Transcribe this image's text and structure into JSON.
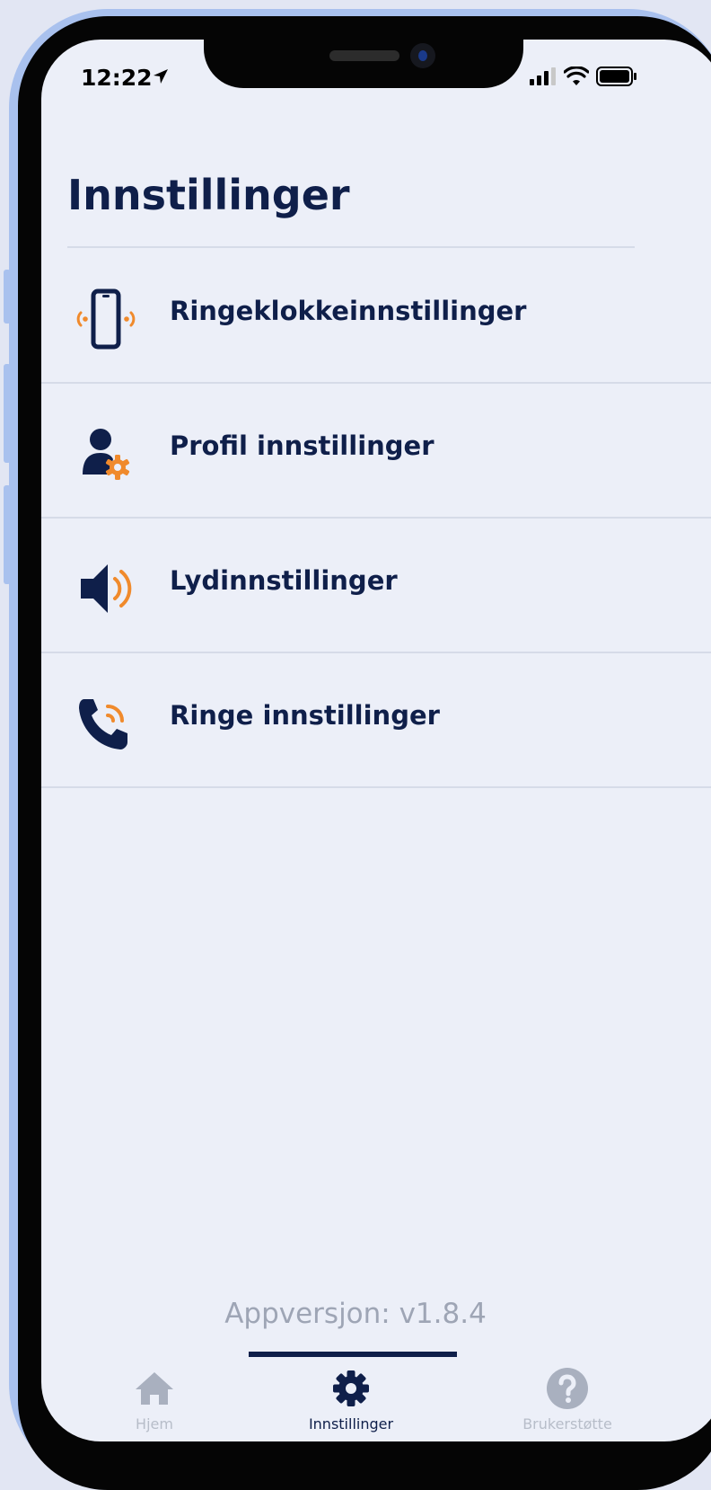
{
  "status_bar": {
    "time": "12:22"
  },
  "page": {
    "title": "Innstillinger"
  },
  "settings": [
    {
      "label": "Ringeklokkeinnstillinger",
      "icon": "phone-vibrate-icon"
    },
    {
      "label": "Profil innstillinger",
      "icon": "user-gear-icon"
    },
    {
      "label": "Lydinnstillinger",
      "icon": "speaker-icon"
    },
    {
      "label": "Ringe innstillinger",
      "icon": "phone-call-icon"
    }
  ],
  "app_version": "Appversjon: v1.8.4",
  "tabs": [
    {
      "label": "Hjem",
      "icon": "home-icon",
      "active": false
    },
    {
      "label": "Innstillinger",
      "icon": "gear-icon",
      "active": true
    },
    {
      "label": "Brukerstøtte",
      "icon": "help-icon",
      "active": false
    }
  ],
  "colors": {
    "primary": "#0f1f4a",
    "accent": "#f08a2c",
    "background": "#eceff8",
    "inactive": "#b7bdc9"
  }
}
